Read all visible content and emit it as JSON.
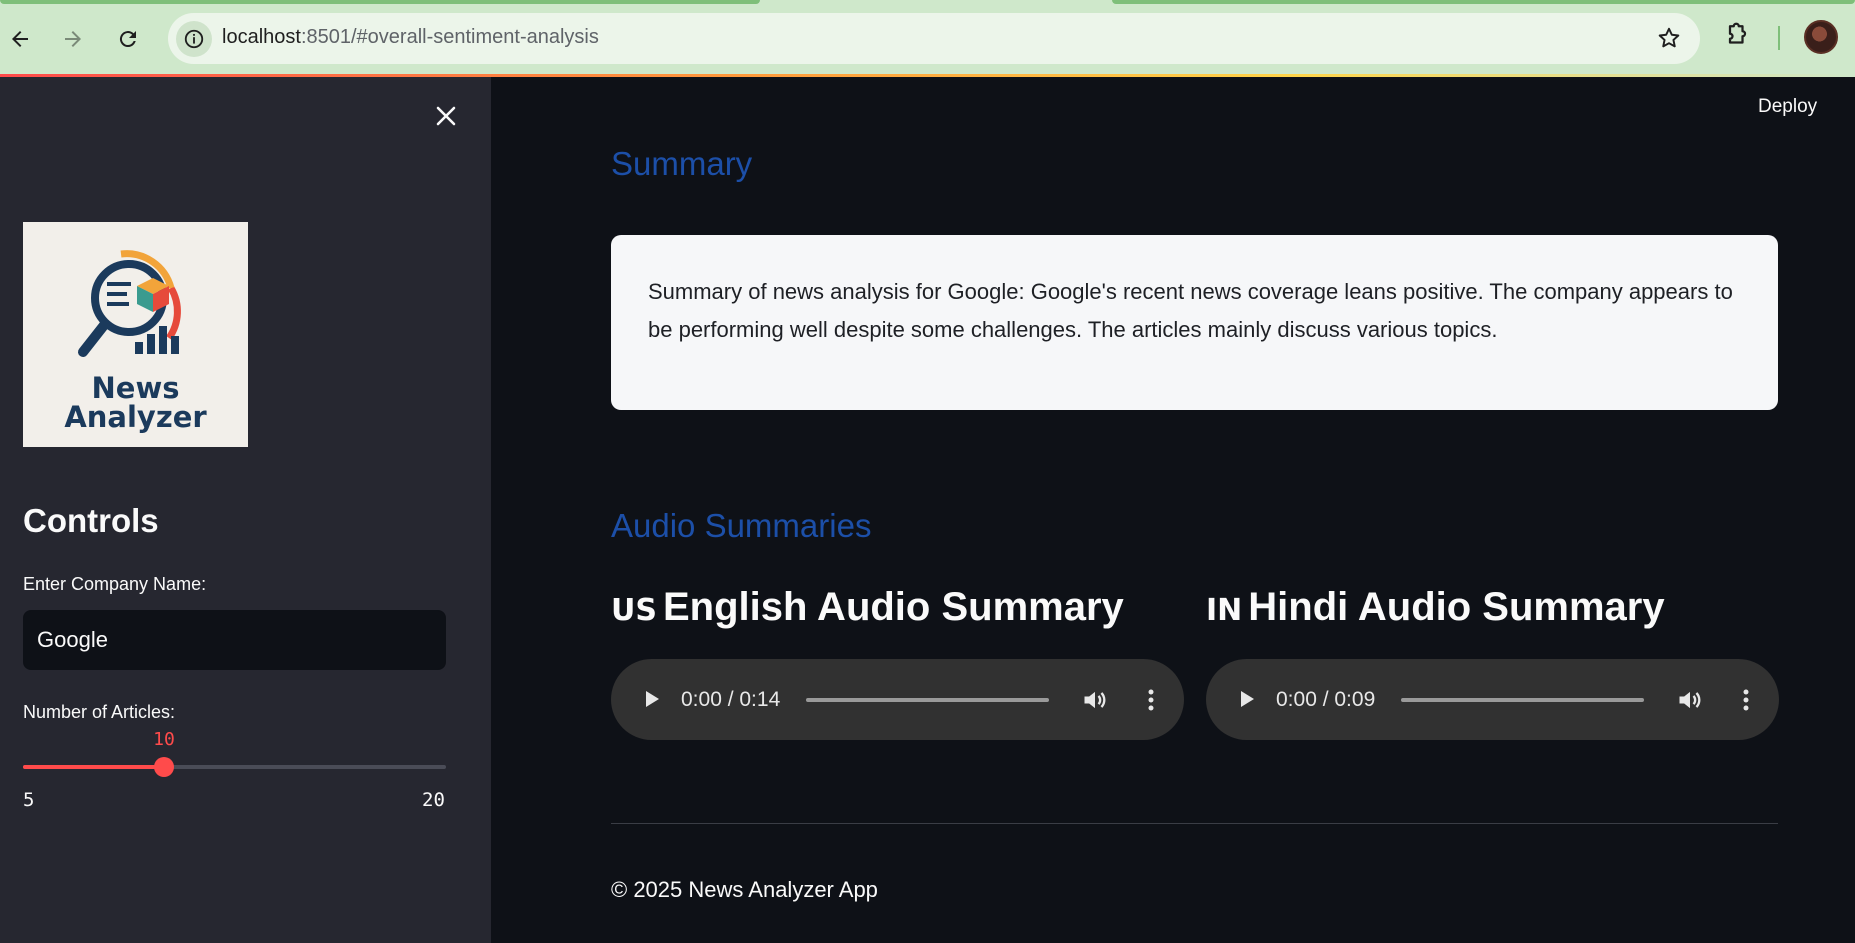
{
  "browser": {
    "url_host": "localhost",
    "url_rest": ":8501/#overall-sentiment-analysis"
  },
  "sidebar": {
    "logo_line1": "News",
    "logo_line2": "Analyzer",
    "controls_title": "Controls",
    "company_label": "Enter Company Name:",
    "company_value": "Google",
    "articles_label": "Number of Articles:",
    "articles_value": 10,
    "articles_min": 5,
    "articles_max": 20
  },
  "header": {
    "deploy_label": "Deploy"
  },
  "main": {
    "summary_heading": "Summary",
    "summary_text": "Summary of news analysis for Google: Google's recent news coverage leans positive. The company appears to be performing well despite some challenges. The articles mainly discuss various topics.",
    "audio_heading": "Audio Summaries",
    "english": {
      "flag": "US",
      "title": "English Audio Summary",
      "time": "0:00 / 0:14"
    },
    "hindi": {
      "flag": "IN",
      "title": "Hindi Audio Summary",
      "time": "0:00 / 0:09"
    },
    "footer": "© 2025 News Analyzer App"
  },
  "colors": {
    "accent": "#ff4b4b",
    "heading_blue": "#1c4fa8",
    "background": "#0e1117",
    "sidebar": "#262730"
  }
}
